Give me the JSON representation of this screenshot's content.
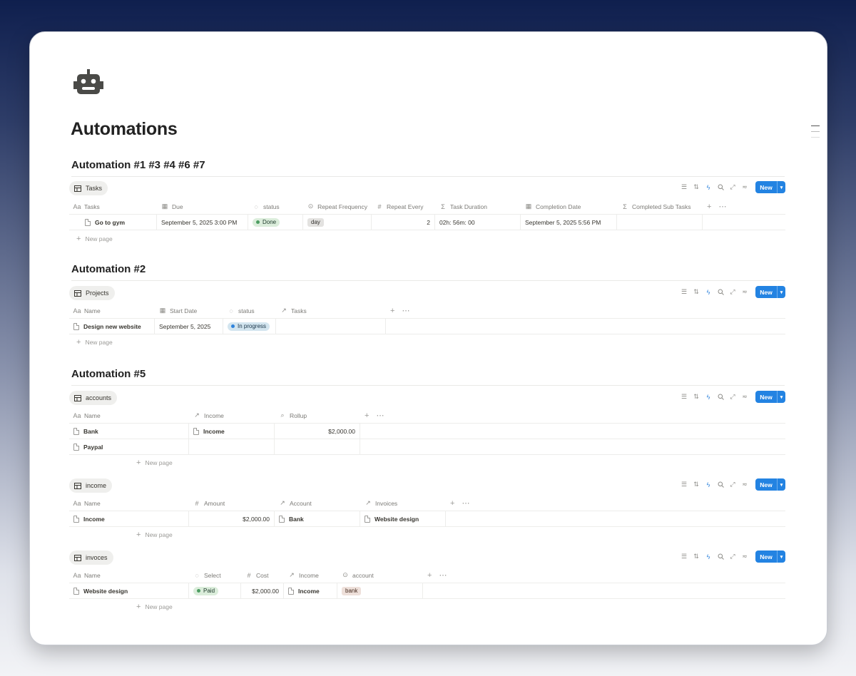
{
  "page": {
    "title": "Automations",
    "icon": "robot-icon"
  },
  "sections": {
    "s1": "Automation #1 #3 #4 #6 #7",
    "s2": "Automation #2",
    "s3": "Automation #5"
  },
  "toolbar": {
    "new_label": "New"
  },
  "new_page": "New page",
  "tasks": {
    "tab": "Tasks",
    "headers": [
      "Tasks",
      "Due",
      "status",
      "Repeat Frequency",
      "Repeat Every",
      "Task Duration",
      "Completion Date",
      "Completed Sub Tasks"
    ],
    "row": {
      "name": "Go to gym",
      "due": "September 5, 2025 3:00 PM",
      "status": "Done",
      "freq": "day",
      "every": "2",
      "duration": "02h: 56m: 00",
      "completion": "September 5, 2025 5:56 PM",
      "subtasks": ""
    }
  },
  "projects": {
    "tab": "Projects",
    "headers": [
      "Name",
      "Start Date",
      "status",
      "Tasks"
    ],
    "row": {
      "name": "Design new website",
      "start": "September 5, 2025",
      "status": "In progress",
      "tasks": ""
    }
  },
  "accounts": {
    "tab": "accounts",
    "headers": [
      "Name",
      "Income",
      "Rollup"
    ],
    "rows": [
      {
        "name": "Bank",
        "income": "Income",
        "rollup": "$2,000.00"
      },
      {
        "name": "Paypal",
        "income": "",
        "rollup": ""
      }
    ]
  },
  "income": {
    "tab": "income",
    "headers": [
      "Name",
      "Amount",
      "Account",
      "Invoices"
    ],
    "row": {
      "name": "Income",
      "amount": "$2,000.00",
      "account": "Bank",
      "invoices": "Website design"
    }
  },
  "invoices": {
    "tab": "invoces",
    "headers": [
      "Name",
      "Select",
      "Cost",
      "Income",
      "account"
    ],
    "row": {
      "name": "Website design",
      "select": "Paid",
      "cost": "$2,000.00",
      "income": "Income",
      "account": "bank"
    }
  },
  "colors": {
    "accent": "#2383e2",
    "done": "#dbeddb",
    "in_progress": "#d3e5ef",
    "bank_tag": "#eee0da"
  }
}
